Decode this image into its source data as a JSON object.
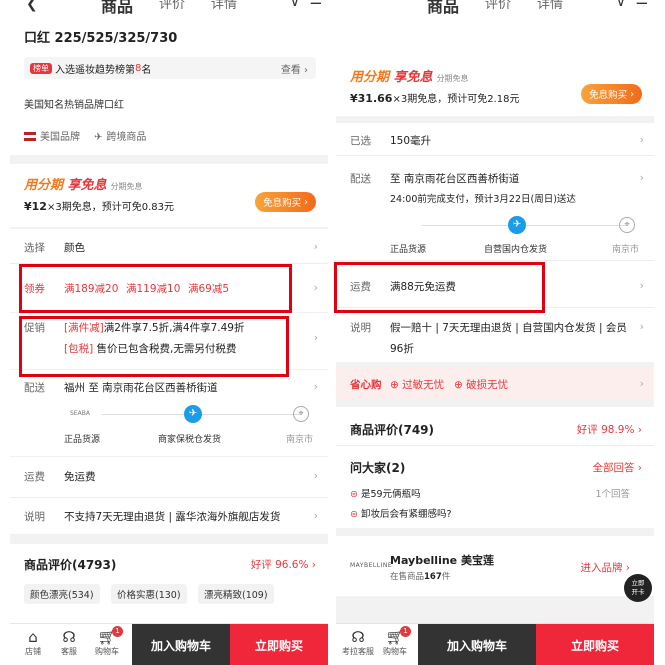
{
  "left": {
    "header": {
      "tabs": [
        "商品",
        "评价",
        "详情"
      ]
    },
    "product_title": "口红 225/525/325/730",
    "rank": {
      "badge": "榜单",
      "text_prefix": "入选遥妆趋势榜第",
      "rank_number": "8",
      "text_suffix": "名",
      "view": "查看"
    },
    "subtitle": "美国知名热销品牌口红",
    "brand_tags": [
      "美国品牌",
      "跨境商品"
    ],
    "installment": {
      "title_a": "用分期",
      "title_b": "享免息",
      "badge": "分期免息",
      "price": "¥12",
      "detail": "×3期免息，预计可免0.83元",
      "button": "免息购买"
    },
    "select": {
      "label": "选择",
      "value": "颜色"
    },
    "coupons": {
      "label": "领券",
      "items": [
        "满189减20",
        "满119减10",
        "满69减5"
      ]
    },
    "promo": {
      "label": "促销",
      "line1_tag": "[满件减]",
      "line1_text": "满2件享7.5折,满4件享7.49折",
      "line2_tag": "[包税]",
      "line2_text": "售价已包含税费,无需另付税费"
    },
    "delivery": {
      "label": "配送",
      "value": "福州 至 南京雨花台区西善桥街道",
      "origin_logo": "SEABA",
      "steps": [
        "正品货源",
        "商家保税仓发货",
        "南京市"
      ]
    },
    "shipping": {
      "label": "运费",
      "value": "免运费"
    },
    "note": {
      "label": "说明",
      "value": "不支持7天无理由退货 | 露华浓海外旗舰店发货"
    },
    "reviews": {
      "title": "商品评价(4793)",
      "rate": "好评 96.6%",
      "chips": [
        "颜色漂亮(534)",
        "价格实惠(130)",
        "漂亮精致(109)"
      ]
    },
    "bottom_bar": {
      "icons": [
        "店铺",
        "客服",
        "购物车"
      ],
      "cart_count": "1",
      "add_cart": "加入购物车",
      "buy_now": "立即购买"
    }
  },
  "right": {
    "header": {
      "tabs": [
        "商品",
        "评价",
        "详情"
      ]
    },
    "installment": {
      "title_a": "用分期",
      "title_b": "享免息",
      "badge": "分期免息",
      "price": "¥31.66",
      "detail": "×3期免息，预计可免2.18元",
      "button": "免息购买"
    },
    "selected": {
      "label": "已选",
      "value": "150毫升"
    },
    "delivery": {
      "label": "配送",
      "value": "至 南京雨花台区西善桥街道",
      "detail": "24:00前完成支付，预计3月22日(周日)送达",
      "steps": [
        "正品货源",
        "自营国内仓发货",
        "南京市"
      ]
    },
    "shipping": {
      "label": "运费",
      "value": "满88元免运费"
    },
    "note": {
      "label": "说明",
      "value_line1": "假一赔十 | 7天无理由退货 | 自营国内仓发货 | 会员",
      "value_line2": "96折"
    },
    "savings": {
      "label": "省心购",
      "items": [
        "过敏无忧",
        "破损无忧"
      ]
    },
    "reviews": {
      "title": "商品评价(749)",
      "rate": "好评 98.9%"
    },
    "qa": {
      "title": "问大家(2)",
      "all": "全部回答",
      "items": [
        {
          "q": "是59元俩瓶吗",
          "a": "1个回答"
        },
        {
          "q": "卸妆后会有紧绷感吗?",
          "a": ""
        }
      ]
    },
    "brand": {
      "logo": "MAYBELLINE",
      "name": "Maybelline 美宝莲",
      "count_prefix": "在售商品",
      "count": "167",
      "count_suffix": "件",
      "enter": "进入品牌"
    },
    "float_btn": {
      "line1": "立即",
      "line2": "开卡"
    },
    "bottom_bar": {
      "icons": [
        "考拉客服",
        "购物车"
      ],
      "cart_count": "1",
      "add_cart": "加入购物车",
      "buy_now": "立即购买"
    }
  }
}
